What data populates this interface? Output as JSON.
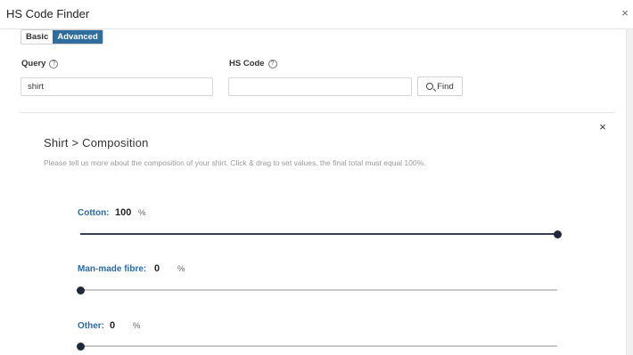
{
  "window": {
    "title": "HS Code Finder",
    "close_glyph": "×"
  },
  "mode_toggle": {
    "basic_label": "Basic",
    "advanced_label": "Advanced",
    "active": "advanced"
  },
  "query": {
    "label": "Query",
    "value": "shirt",
    "placeholder": ""
  },
  "hs_code": {
    "label": "HS Code",
    "value": "",
    "placeholder": ""
  },
  "find_button": {
    "label": "Find",
    "icon": "search-icon"
  },
  "panel": {
    "title": "Shirt > Composition",
    "description": "Please tell us more about the composition of your shirt. Click & drag to set values, the final total must equal 100%.",
    "close_glyph": "×"
  },
  "sliders": [
    {
      "label": "Cotton:",
      "value": 100,
      "unit": "%"
    },
    {
      "label": "Man-made fibre:",
      "value": 0,
      "unit": "%"
    },
    {
      "label": "Other:",
      "value": 0,
      "unit": "%"
    }
  ],
  "colors": {
    "accent": "#2e6d9e",
    "slider_label": "#2b6aa3",
    "thumb": "#1e2a3a"
  }
}
